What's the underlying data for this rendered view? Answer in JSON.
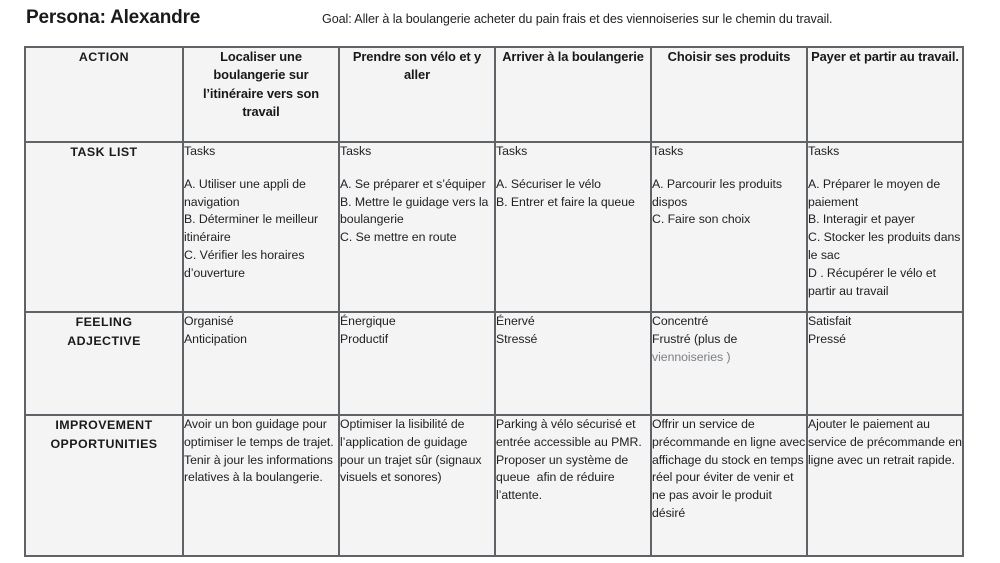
{
  "header": {
    "persona_label": "Persona: Alexandre",
    "goal": "Goal: Aller à la boulangerie acheter du pain frais et des viennoiseries sur le chemin du travail."
  },
  "matrix": {
    "row_labels": {
      "action": "ACTION",
      "task_list": "TASK LIST",
      "feeling_adjective": "FEELING\nADJECTIVE",
      "improvement_opportunities": "IMPROVEMENT\nOPPORTUNITIES"
    },
    "tasks_heading": "Tasks",
    "stages": [
      {
        "action": "Localiser une boulangerie sur l’itinéraire vers son travail",
        "tasks": "A. Utiliser une appli de navigation\nB. Déterminer le meilleur itinéraire\nC. Vérifier les horaires d’ouverture",
        "feeling": "Organisé\nAnticipation",
        "feeling_muted": "",
        "improvement": "Avoir un bon guidage pour optimiser le temps de trajet.\nTenir à jour les informations relatives à la boulangerie."
      },
      {
        "action": "Prendre son vélo et y aller",
        "tasks": "A. Se préparer et s’équiper\nB. Mettre le guidage vers la boulangerie\nC. Se mettre en route",
        "feeling": "Énergique\nProductif",
        "feeling_muted": "",
        "improvement": "Optimiser la lisibilité de l’application de guidage pour un trajet sûr (signaux visuels et sonores)"
      },
      {
        "action": "Arriver à la boulangerie",
        "tasks": "A. Sécuriser le vélo\nB. Entrer et faire la queue",
        "feeling": "Énervé\nStressé",
        "feeling_muted": "",
        "improvement": "Parking à vélo sécurisé et entrée accessible au PMR. Proposer un système de queue  afin de réduire l’attente."
      },
      {
        "action": "Choisir ses produits",
        "tasks": "A. Parcourir les produits dispos\nC. Faire son choix",
        "feeling": "Concentré\nFrustré (plus de ",
        "feeling_muted": "viennoiseries )",
        "improvement": "Offrir un service de précommande en ligne avec affichage du stock en temps réel pour éviter de venir et ne pas avoir le produit désiré"
      },
      {
        "action": "Payer et partir au travail.",
        "tasks": "A. Préparer le moyen de paiement\nB. Interagir et payer\nC. Stocker les produits dans le sac\nD . Récupérer le vélo et partir au travail",
        "feeling": "Satisfait\nPressé",
        "feeling_muted": "",
        "improvement": "Ajouter le paiement au service de précommande en ligne avec un retrait rapide."
      }
    ]
  },
  "colors": {
    "action_header_bg": "#d3e2f9",
    "cell_bg": "#f4f4f4",
    "border": "#5f6368",
    "muted_text": "#7b7f84"
  }
}
